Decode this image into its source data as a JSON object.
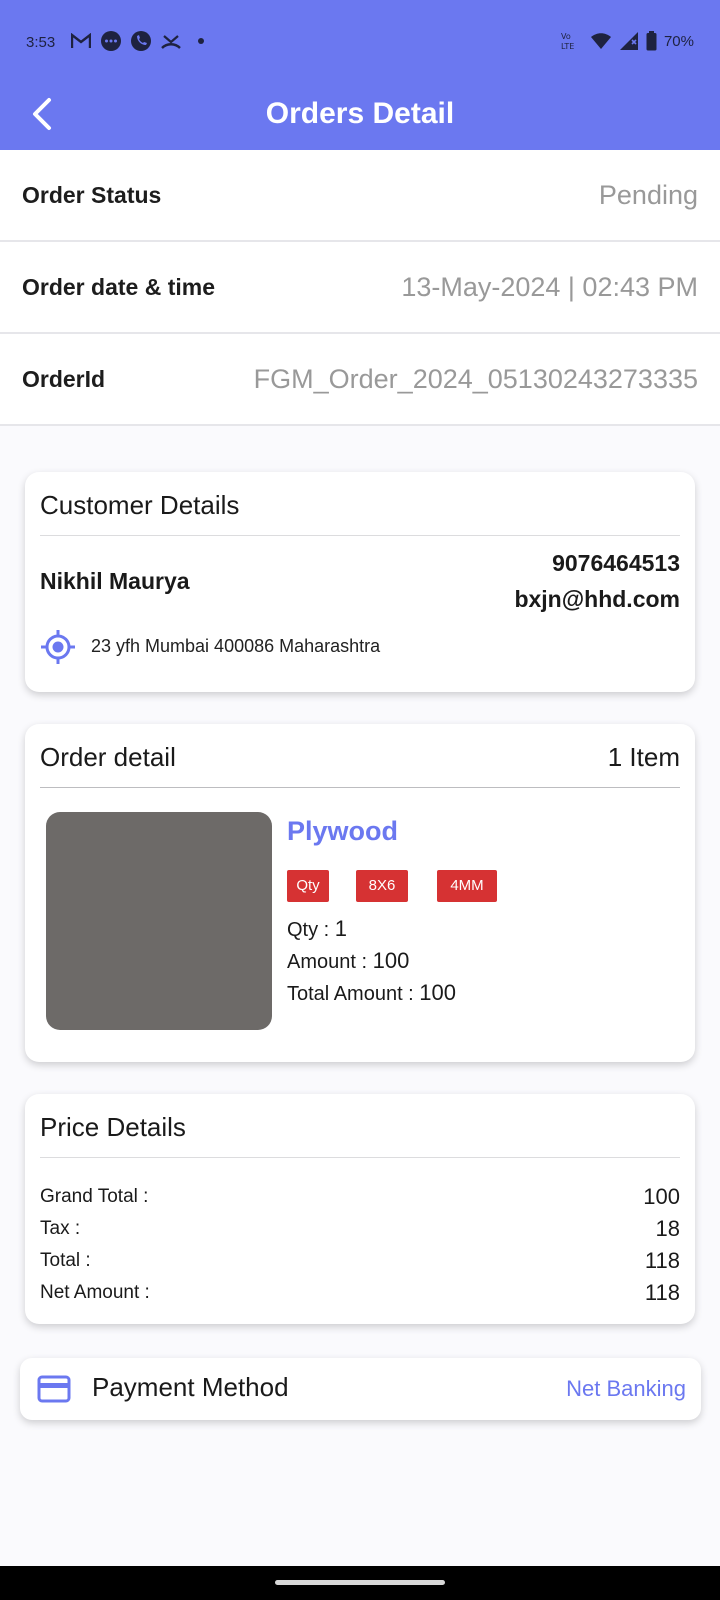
{
  "status_bar": {
    "time": "3:53",
    "left_icons": [
      "gmail-icon",
      "chat-bubble-icon",
      "phone-call-icon",
      "missed-call-icon",
      "dot-icon"
    ],
    "network": "Vo LTE",
    "battery": "70%"
  },
  "app_bar": {
    "title": "Orders Detail",
    "back_icon": "arrow-back-icon",
    "color": "#6b78f0"
  },
  "order_info": {
    "status_label": "Order Status",
    "status_value": "Pending",
    "date_label": "Order date & time",
    "date_value": "13-May-2024 | 02:43 PM",
    "id_label": "OrderId",
    "id_value": "FGM_Order_2024_05130243273335"
  },
  "customer": {
    "title": "Customer Details",
    "name": "Nikhil Maurya",
    "phone": "9076464513",
    "email": "bxjn@hhd.com",
    "address": "23 yfh Mumbai 400086 Maharashtra",
    "location_icon": "location-target-icon"
  },
  "order_detail": {
    "title": "Order detail",
    "item_count": "1 Item",
    "product": {
      "name": "Plywood",
      "tags": [
        "Qty",
        "8X6",
        "4MM"
      ],
      "qty_label": "Qty : ",
      "qty_value": "1",
      "amount_label": "Amount : ",
      "amount_value": "100",
      "total_label": "Total Amount : ",
      "total_value": "100"
    }
  },
  "price_details": {
    "title": "Price Details",
    "rows": [
      {
        "label": "Grand Total :",
        "value": "100"
      },
      {
        "label": "Tax :",
        "value": "18"
      },
      {
        "label": "Total :",
        "value": "118"
      },
      {
        "label": "Net Amount :",
        "value": "118"
      }
    ]
  },
  "payment": {
    "label": "Payment Method",
    "value": "Net Banking",
    "icon": "credit-card-icon"
  },
  "colors": {
    "accent": "#6b78f0",
    "tag_red": "#d63233",
    "muted_text": "#999999"
  }
}
